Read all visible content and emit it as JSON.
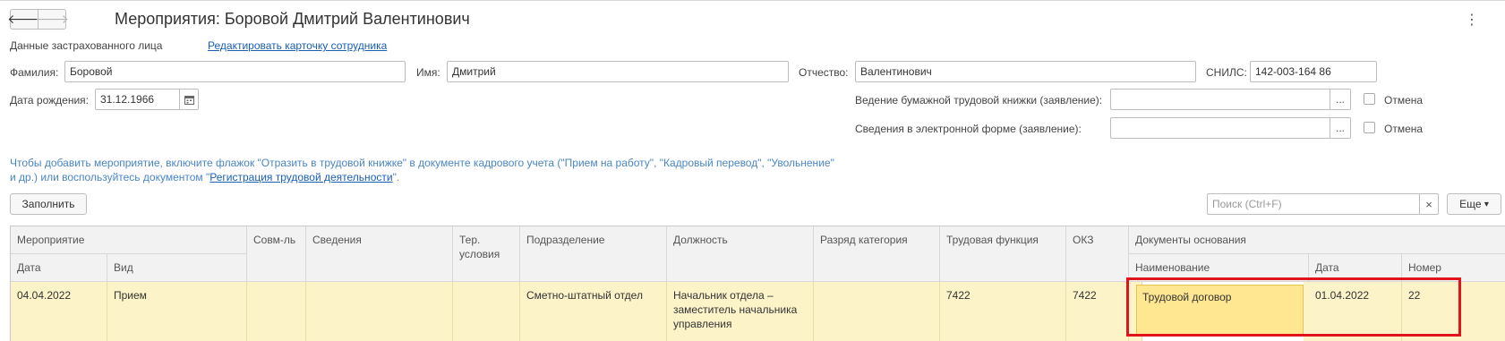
{
  "window": {
    "title": "Мероприятия: Боровой Дмитрий Валентинович",
    "back_glyph": "🡐",
    "forward_glyph": "🡒",
    "more_glyph": "⋮"
  },
  "insured": {
    "section_label": "Данные застрахованного лица",
    "edit_link": "Редактировать карточку сотрудника"
  },
  "fields": {
    "surname_label": "Фамилия:",
    "surname_value": "Боровой",
    "name_label": "Имя:",
    "name_value": "Дмитрий",
    "patronymic_label": "Отчество:",
    "patronymic_value": "Валентинович",
    "snils_label": "СНИЛС:",
    "snils_value": "142-003-164 86",
    "birth_label": "Дата рождения:",
    "birth_value": "31.12.1966",
    "paper_book_label": "Ведение бумажной трудовой книжки (заявление):",
    "paper_book_value": "",
    "paper_book_cancel": "Отмена",
    "electronic_label": "Сведения в электронной форме (заявление):",
    "electronic_value": "",
    "electronic_cancel": "Отмена",
    "select_glyph": "..."
  },
  "hint": {
    "line1": "Чтобы добавить мероприятие, включите флажок \"Отразить в трудовой книжке\" в документе кадрового учета (\"Прием на работу\", \"Кадровый перевод\", \"Увольнение\"",
    "line2_prefix": "и др.) или воспользуйтесь документом \"",
    "line2_link": "Регистрация трудовой деятельности",
    "line2_suffix": "\"."
  },
  "toolbar": {
    "fill_button": "Заполнить",
    "search_placeholder": "Поиск (Ctrl+F)",
    "search_clear": "×",
    "more_button": "Еще",
    "more_arrow": "▾"
  },
  "table": {
    "headers": {
      "event": "Мероприятие",
      "date": "Дата",
      "kind": "Вид",
      "combined": "Совм-ль",
      "info": "Сведения",
      "territory": "Тер. условия",
      "department": "Подразделение",
      "position": "Должность",
      "grade": "Разряд категория",
      "labor_function": "Трудовая функция",
      "okz": "ОКЗ",
      "docs": "Документы основания",
      "doc_name": "Наименование",
      "doc_date": "Дата",
      "doc_number": "Номер"
    },
    "rows": [
      {
        "date": "04.04.2022",
        "kind": "Прием",
        "combined": "",
        "info": "",
        "territory": "",
        "department": "Сметно-штатный отдел",
        "position": "Начальник отдела – заместитель начальника управления",
        "grade": "",
        "labor_function": "7422",
        "okz": "7422",
        "doc_name": "Трудовой договор",
        "doc_date": "01.04.2022",
        "doc_number": "22"
      }
    ]
  },
  "colors": {
    "accent_link": "#1a5fb4",
    "hint_text": "#4a86c5",
    "row_highlight": "#fcf3c8",
    "cell_focus": "#ffe691",
    "annotation_box": "#e0141a"
  }
}
